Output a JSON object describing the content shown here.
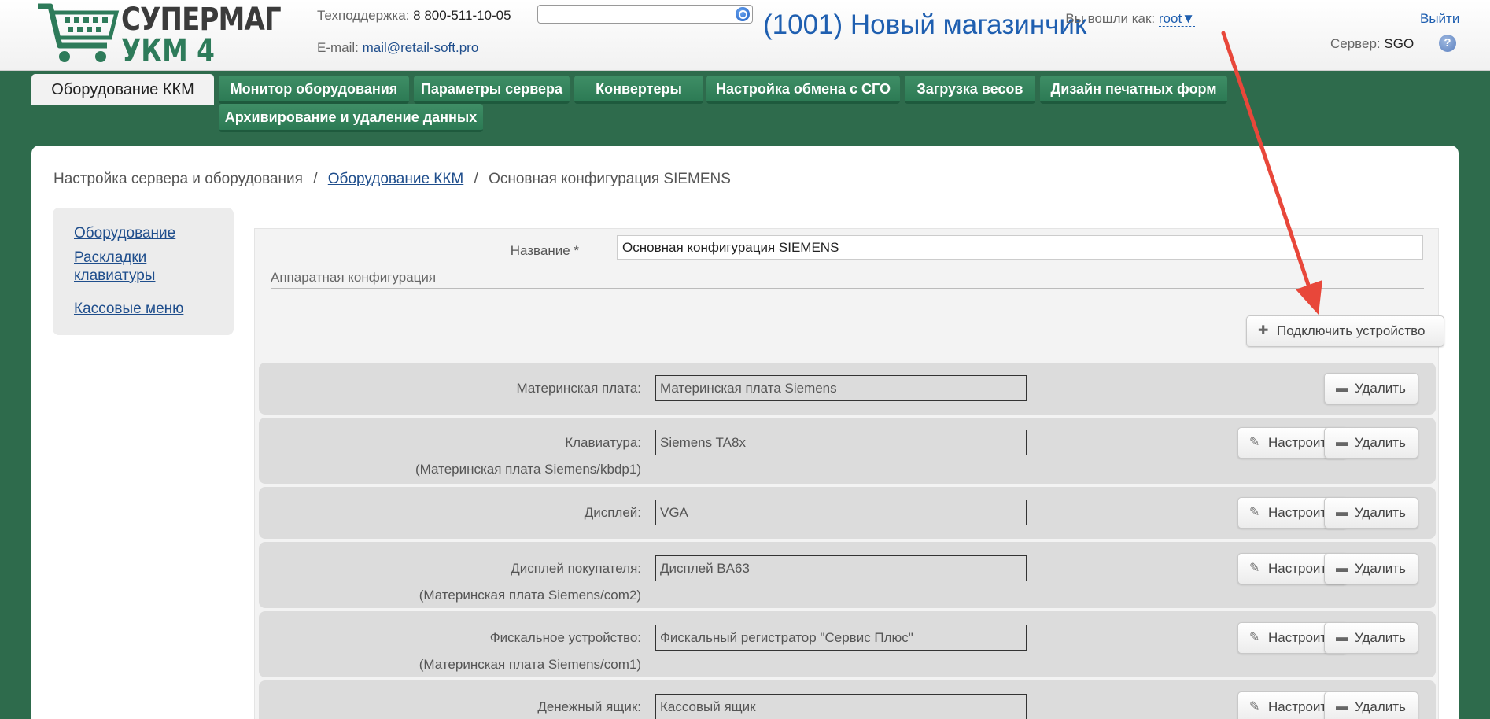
{
  "header": {
    "logo_line1": "СУПЕРМАГ",
    "logo_line2": "УКМ 4",
    "support_label": "Техподдержка:",
    "support_phone": "8 800-511-10-05",
    "email_label": "E-mail:",
    "email": "mail@retail-soft.pro",
    "search_value": "",
    "shop_title": "(1001) Новый магазинчик",
    "login_label": "Вы вошли как:",
    "user": "root▼",
    "logout": "Выйти",
    "server_label": "Сервер:",
    "server_value": "SGO",
    "help": "?"
  },
  "nav": {
    "active": "Оборудование ККМ",
    "tabs": [
      "Монитор оборудования",
      "Параметры сервера",
      "Конвертеры",
      "Настройка обмена с СГО",
      "Загрузка весов",
      "Дизайн печатных форм",
      "Архивирование и удаление данных"
    ]
  },
  "breadcrumb": {
    "root": "Настройка сервера и оборудования",
    "link": "Оборудование ККМ",
    "current": "Основная конфигурация SIEMENS",
    "sep": "/"
  },
  "sidebar": {
    "items": [
      "Оборудование",
      "Раскладки",
      "клавиатуры",
      "Кассовые меню"
    ]
  },
  "form": {
    "name_label": "Название *",
    "name_value": "Основная конфигурация SIEMENS",
    "section_title": "Аппаратная конфигурация",
    "connect_button": "Подключить устройство",
    "configure_label": "Настроить",
    "delete_label": "Удалить",
    "devices": [
      {
        "label": "Материнская плата:",
        "sub": "",
        "value": "Материнская плата Siemens"
      },
      {
        "label": "Клавиатура:",
        "sub": "(Материнская плата Siemens/kbdp1)",
        "value": "Siemens TA8x"
      },
      {
        "label": "Дисплей:",
        "sub": "",
        "value": "VGA"
      },
      {
        "label": "Дисплей покупателя:",
        "sub": "(Материнская плата Siemens/com2)",
        "value": "Дисплей BA63"
      },
      {
        "label": "Фискальное устройство:",
        "sub": "(Материнская плата Siemens/com1)",
        "value": "Фискальный регистратор \"Сервис Плюс\""
      },
      {
        "label": "Денежный ящик:",
        "sub": "",
        "value": "Кассовый ящик"
      }
    ]
  },
  "colors": {
    "background": "#2e6b4c",
    "nav_tab": "#2c7a54",
    "link": "#1f4e8c",
    "arrow": "#e8473a"
  }
}
